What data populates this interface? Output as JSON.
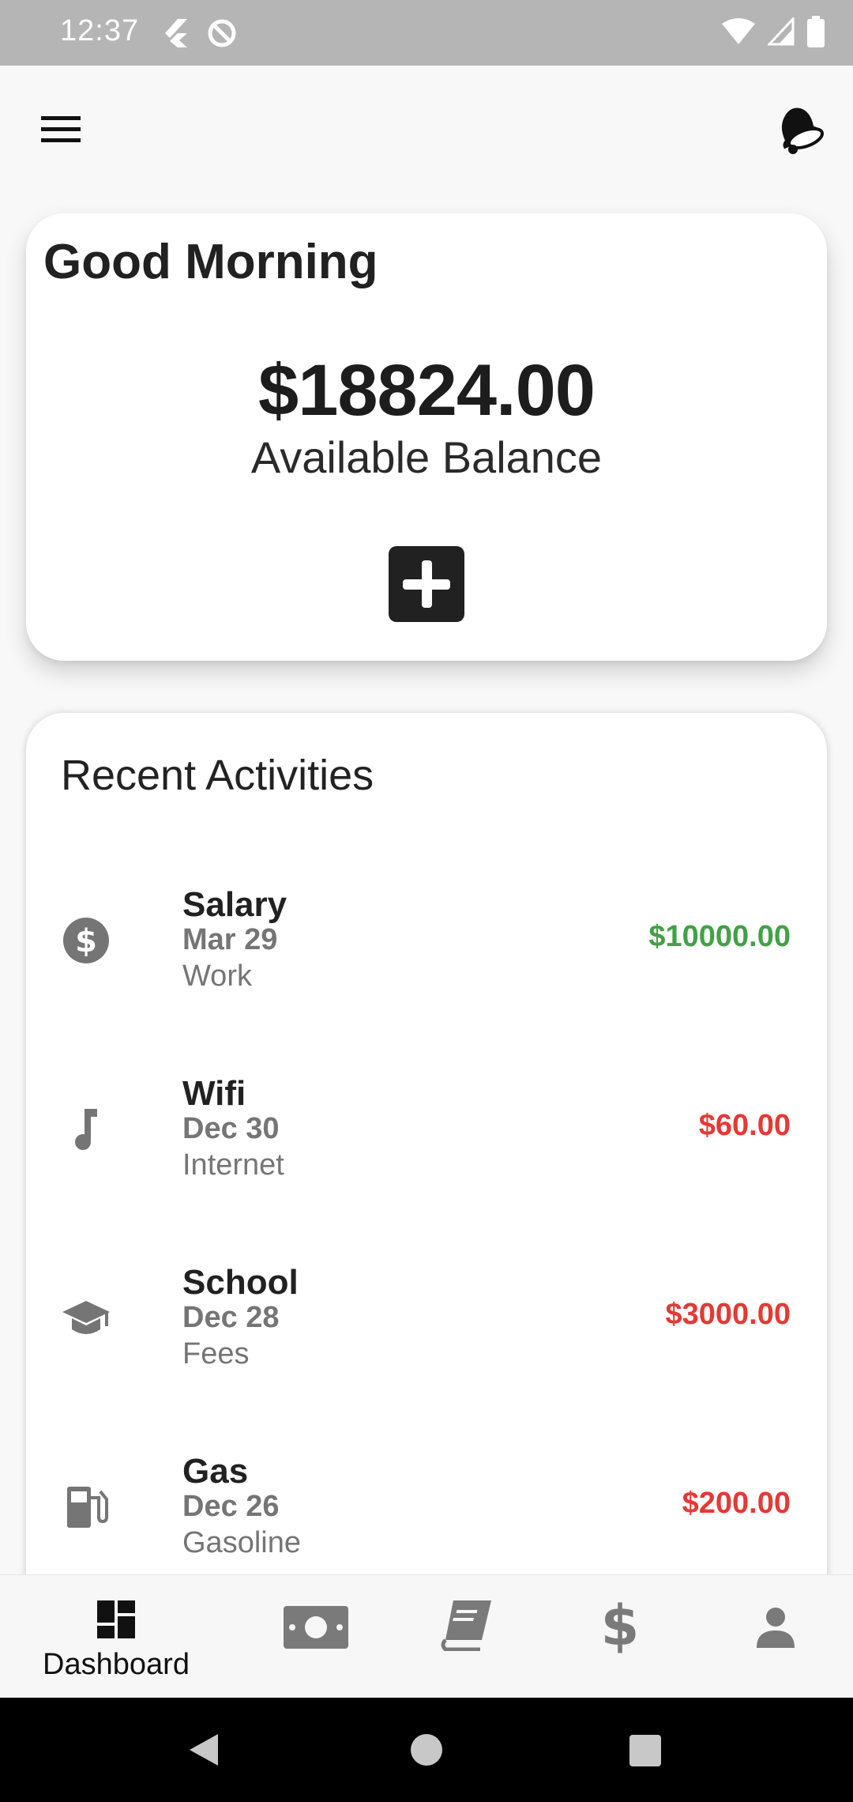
{
  "status_bar": {
    "time": "12:37"
  },
  "greeting": "Good Morning",
  "balance": {
    "amount": "$18824.00",
    "label": "Available Balance"
  },
  "recent_activities": {
    "title": "Recent Activities",
    "items": [
      {
        "title": "Salary",
        "date": "Mar 29",
        "category": "Work",
        "amount": "$10000.00",
        "icon": "dollar-circle-icon",
        "type": "income"
      },
      {
        "title": "Wifi",
        "date": "Dec 30",
        "category": "Internet",
        "amount": "$60.00",
        "icon": "music-note-icon",
        "type": "expense"
      },
      {
        "title": "School",
        "date": "Dec 28",
        "category": "Fees",
        "amount": "$3000.00",
        "icon": "graduation-cap-icon",
        "type": "expense"
      },
      {
        "title": "Gas",
        "date": "Dec 26",
        "category": "Gasoline",
        "amount": "$200.00",
        "icon": "gas-station-icon",
        "type": "expense"
      }
    ]
  },
  "bottom_nav": {
    "active_label": "Dashboard",
    "items": [
      "dashboard-icon",
      "money-bill-icon",
      "book-icon",
      "dollar-icon",
      "person-icon"
    ]
  },
  "colors": {
    "income": "#43a047",
    "expense": "#e53935",
    "status_bar": "#b5b5b5"
  }
}
